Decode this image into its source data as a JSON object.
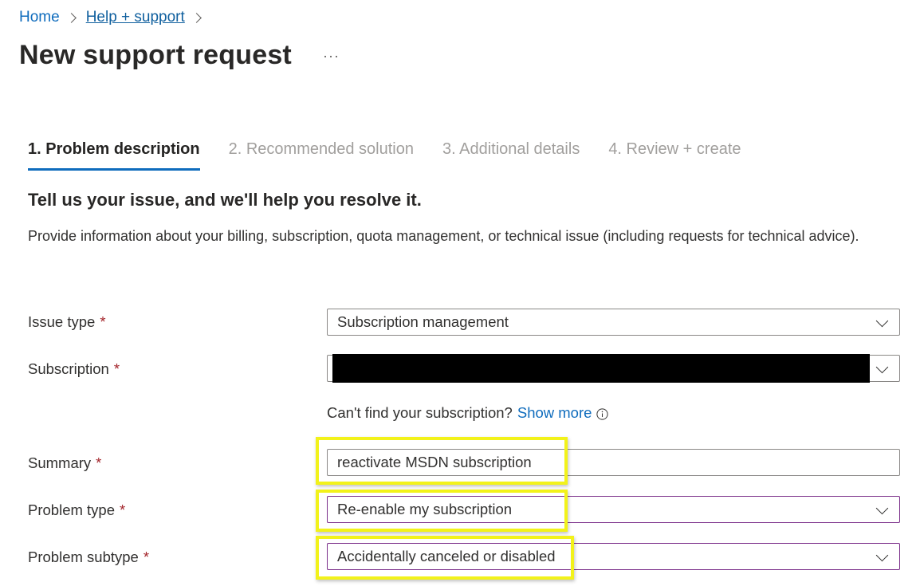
{
  "breadcrumb": {
    "home": "Home",
    "help": "Help + support"
  },
  "page": {
    "title": "New support request",
    "more": "···"
  },
  "tabs": [
    {
      "label": "1. Problem description",
      "active": true
    },
    {
      "label": "2. Recommended solution",
      "active": false
    },
    {
      "label": "3. Additional details",
      "active": false
    },
    {
      "label": "4. Review + create",
      "active": false
    }
  ],
  "section": {
    "heading": "Tell us your issue, and we'll help you resolve it.",
    "description": "Provide information about your billing, subscription, quota management, or technical issue (including requests for technical advice)."
  },
  "form": {
    "required_marker": "*",
    "issue_type": {
      "label": "Issue type",
      "value": "Subscription management"
    },
    "subscription": {
      "label": "Subscription",
      "value": ""
    },
    "subscription_help": {
      "text": "Can't find your subscription?",
      "link": "Show more"
    },
    "summary": {
      "label": "Summary",
      "value": "reactivate MSDN subscription"
    },
    "problem_type": {
      "label": "Problem type",
      "value": "Re-enable my subscription"
    },
    "problem_subtype": {
      "label": "Problem subtype",
      "value": "Accidentally canceled or disabled"
    }
  },
  "icons": {
    "chevron": "chevron-down-icon",
    "separator": "chevron-right-icon",
    "info": "info-icon"
  },
  "colors": {
    "accent": "#0f6cbd",
    "required": "#a4262c",
    "highlight": "#f2f21a",
    "focus_border": "#7b2f8a"
  }
}
